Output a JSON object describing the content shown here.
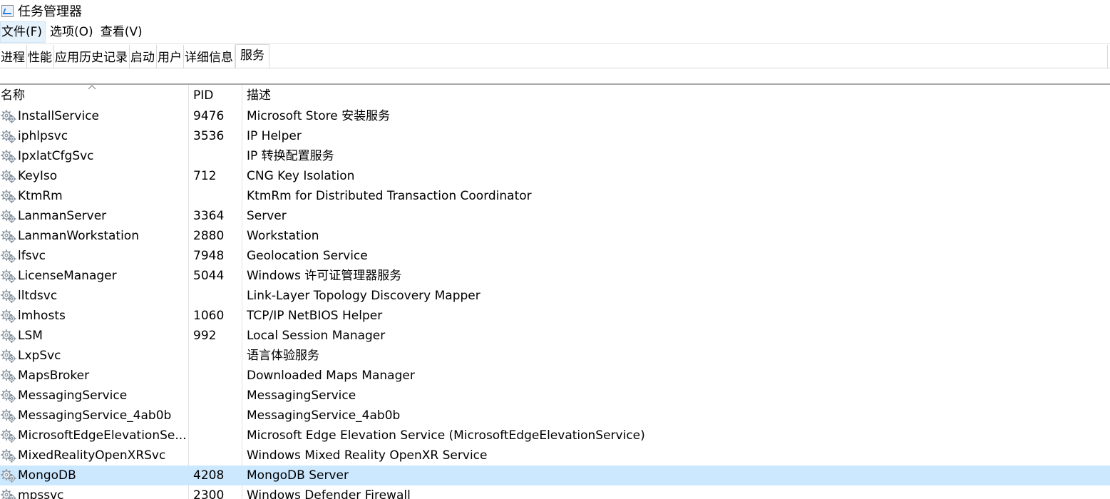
{
  "window": {
    "title": "任务管理器",
    "icon": "task-manager-icon"
  },
  "menu": {
    "file": "文件(F)",
    "options": "选项(O)",
    "view": "查看(V)"
  },
  "tabs": [
    {
      "label": "进程"
    },
    {
      "label": "性能"
    },
    {
      "label": "应用历史记录"
    },
    {
      "label": "启动"
    },
    {
      "label": "用户"
    },
    {
      "label": "详细信息"
    },
    {
      "label": "服务",
      "selected": true
    }
  ],
  "table": {
    "columns": {
      "name": "名称",
      "pid": "PID",
      "desc": "描述"
    },
    "sort": {
      "column": "name",
      "direction": "ascending"
    },
    "rows": [
      {
        "name": "InstallService",
        "pid": "9476",
        "desc": "Microsoft Store 安装服务"
      },
      {
        "name": "iphlpsvc",
        "pid": "3536",
        "desc": "IP Helper"
      },
      {
        "name": "IpxlatCfgSvc",
        "pid": "",
        "desc": "IP 转换配置服务"
      },
      {
        "name": "KeyIso",
        "pid": "712",
        "desc": "CNG Key Isolation"
      },
      {
        "name": "KtmRm",
        "pid": "",
        "desc": "KtmRm for Distributed Transaction Coordinator"
      },
      {
        "name": "LanmanServer",
        "pid": "3364",
        "desc": "Server"
      },
      {
        "name": "LanmanWorkstation",
        "pid": "2880",
        "desc": "Workstation"
      },
      {
        "name": "lfsvc",
        "pid": "7948",
        "desc": "Geolocation Service"
      },
      {
        "name": "LicenseManager",
        "pid": "5044",
        "desc": "Windows 许可证管理器服务"
      },
      {
        "name": "lltdsvc",
        "pid": "",
        "desc": "Link-Layer Topology Discovery Mapper"
      },
      {
        "name": "lmhosts",
        "pid": "1060",
        "desc": "TCP/IP NetBIOS Helper"
      },
      {
        "name": "LSM",
        "pid": "992",
        "desc": "Local Session Manager"
      },
      {
        "name": "LxpSvc",
        "pid": "",
        "desc": "语言体验服务"
      },
      {
        "name": "MapsBroker",
        "pid": "",
        "desc": "Downloaded Maps Manager"
      },
      {
        "name": "MessagingService",
        "pid": "",
        "desc": "MessagingService"
      },
      {
        "name": "MessagingService_4ab0b",
        "pid": "",
        "desc": "MessagingService_4ab0b"
      },
      {
        "name": "MicrosoftEdgeElevationSe...",
        "pid": "",
        "desc": "Microsoft Edge Elevation Service (MicrosoftEdgeElevationService)"
      },
      {
        "name": "MixedRealityOpenXRSvc",
        "pid": "",
        "desc": "Windows Mixed Reality OpenXR Service"
      },
      {
        "name": "MongoDB",
        "pid": "4208",
        "desc": "MongoDB Server",
        "selected": true
      },
      {
        "name": "mpssvc",
        "pid": "2300",
        "desc": "Windows Defender Firewall"
      }
    ]
  },
  "colors": {
    "selected_row": "#cce8ff",
    "menu_active": "#e5f1fb",
    "divider": "#e3e3e3"
  },
  "icons": {
    "row_icon": "service-gears-icon",
    "sort_icon": "sort-ascending-icon"
  }
}
